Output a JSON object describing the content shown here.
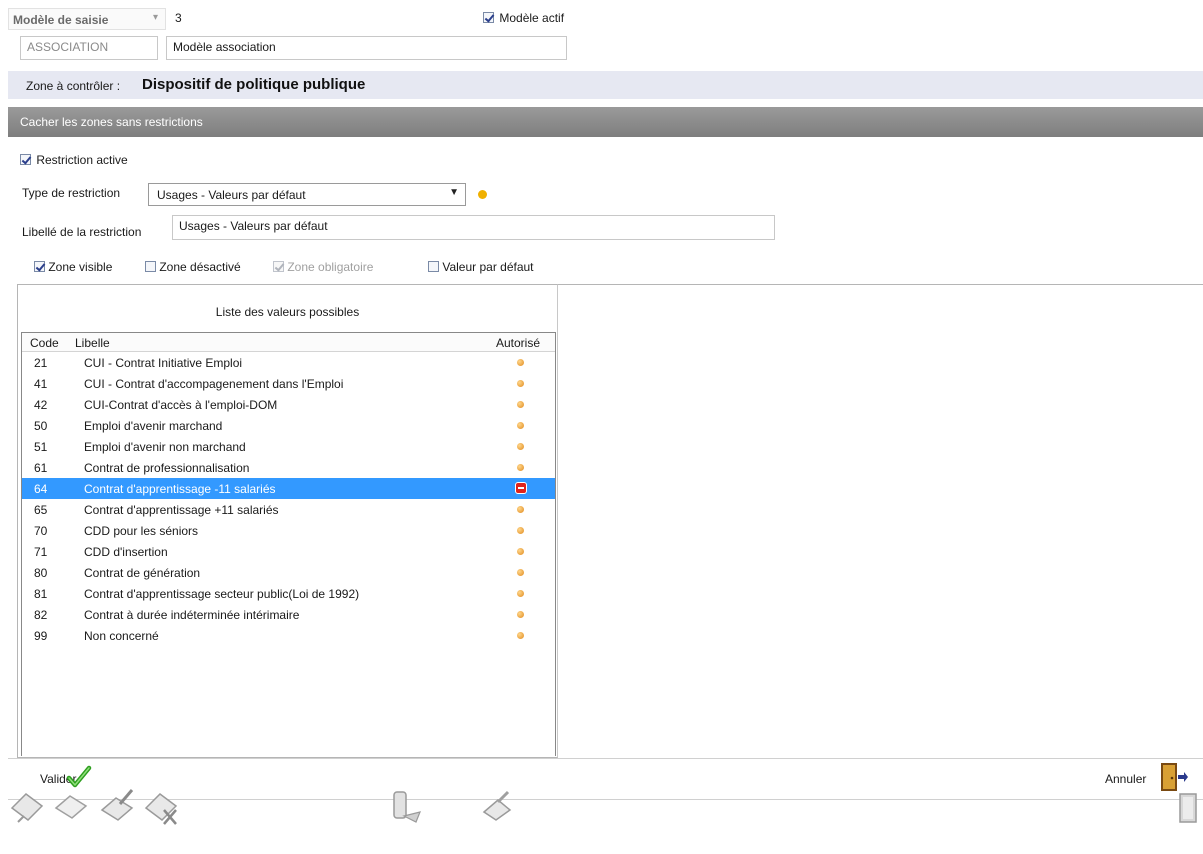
{
  "model": {
    "combo_label": "Modèle de saisie",
    "number": "3",
    "active_label": "Modèle actif",
    "code": "ASSOCIATION",
    "name": "Modèle association"
  },
  "zone": {
    "label": "Zone à contrôler :",
    "value": "Dispositif de politique publique"
  },
  "hide_bar": "Cacher les zones sans restrictions",
  "restriction": {
    "active_label": "Restriction active",
    "type_label": "Type de restriction",
    "type_value": "Usages - Valeurs par défaut",
    "libelle_label": "Libellé de la restriction",
    "libelle_value": "Usages - Valeurs par défaut"
  },
  "options": {
    "visible": "Zone visible",
    "desactive": "Zone désactivé",
    "obligatoire": "Zone obligatoire",
    "defaut": "Valeur par défaut"
  },
  "list": {
    "title": "Liste des valeurs possibles",
    "headers": {
      "code": "Code",
      "libelle": "Libelle",
      "autorise": "Autorisé"
    },
    "rows": [
      {
        "code": "21",
        "libelle": "CUI - Contrat Initiative Emploi"
      },
      {
        "code": "41",
        "libelle": "CUI - Contrat d'accompagenement dans l'Emploi"
      },
      {
        "code": "42",
        "libelle": "CUI-Contrat d'accès à l'emploi-DOM"
      },
      {
        "code": "50",
        "libelle": "Emploi d'avenir marchand"
      },
      {
        "code": "51",
        "libelle": "Emploi d'avenir non marchand"
      },
      {
        "code": "61",
        "libelle": "Contrat de professionnalisation"
      },
      {
        "code": "64",
        "libelle": "Contrat d'apprentissage -11 salariés"
      },
      {
        "code": "65",
        "libelle": "Contrat d'apprentissage +11 salariés"
      },
      {
        "code": "70",
        "libelle": "CDD pour les séniors"
      },
      {
        "code": "71",
        "libelle": "CDD d'insertion"
      },
      {
        "code": "80",
        "libelle": "Contrat de génération"
      },
      {
        "code": "81",
        "libelle": "Contrat d'apprentissage secteur public(Loi de 1992)"
      },
      {
        "code": "82",
        "libelle": "Contrat à durée indéterminée intérimaire"
      },
      {
        "code": "99",
        "libelle": "Non concerné"
      }
    ]
  },
  "footer": {
    "valider": "Valider",
    "annuler": "Annuler"
  },
  "colors": {
    "selection": "#3399ff",
    "zone_bar": "#e6e8f2",
    "hide_bar": "#8c8c8c",
    "status_dot": "#f0b000"
  },
  "icons": [
    "check-icon",
    "exit-door-icon",
    "toolbar-tool-icons"
  ]
}
